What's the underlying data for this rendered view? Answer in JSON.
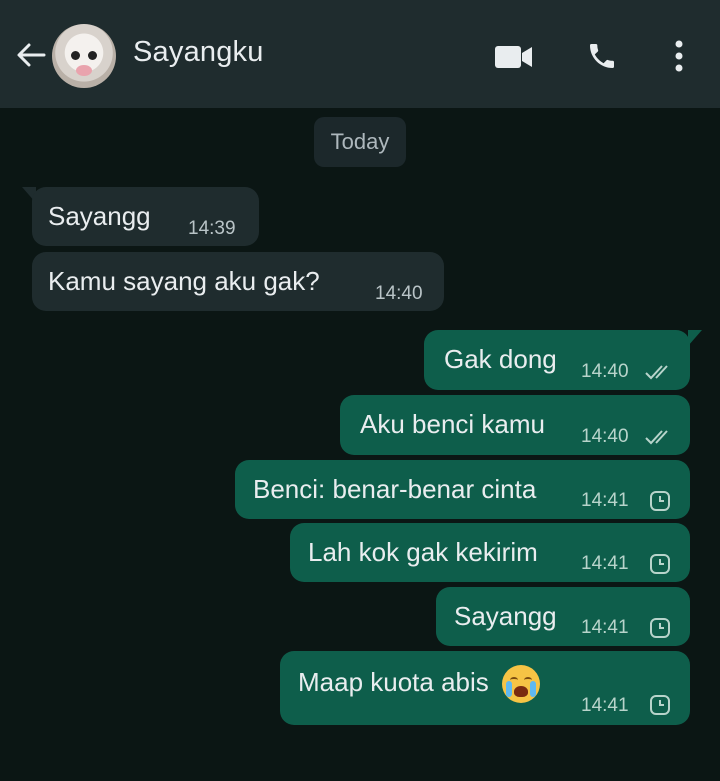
{
  "header": {
    "contact_name": "Sayangku",
    "icons": [
      "back-arrow-icon",
      "video-call-icon",
      "phone-icon",
      "more-options-icon"
    ]
  },
  "date_separator": "Today",
  "messages": [
    {
      "direction": "in",
      "text": "Sayangg",
      "time": "14:39"
    },
    {
      "direction": "in",
      "text": "Kamu sayang aku gak?",
      "time": "14:40"
    },
    {
      "direction": "out",
      "text": "Gak dong",
      "time": "14:40",
      "status": "delivered"
    },
    {
      "direction": "out",
      "text": "Aku benci kamu",
      "time": "14:40",
      "status": "delivered"
    },
    {
      "direction": "out",
      "text": "Benci: benar-benar cinta",
      "time": "14:41",
      "status": "pending"
    },
    {
      "direction": "out",
      "text": "Lah kok gak kekirim",
      "time": "14:41",
      "status": "pending"
    },
    {
      "direction": "out",
      "text": "Sayangg",
      "time": "14:41",
      "status": "pending"
    },
    {
      "direction": "out",
      "text": "Maap kuota abis",
      "emoji": "loudly-crying-face",
      "time": "14:41",
      "status": "pending"
    }
  ],
  "colors": {
    "background": "#0b1614",
    "header": "#1f2c2e",
    "incoming_bubble": "#1f2c2e",
    "outgoing_bubble": "#0e5e4b"
  }
}
